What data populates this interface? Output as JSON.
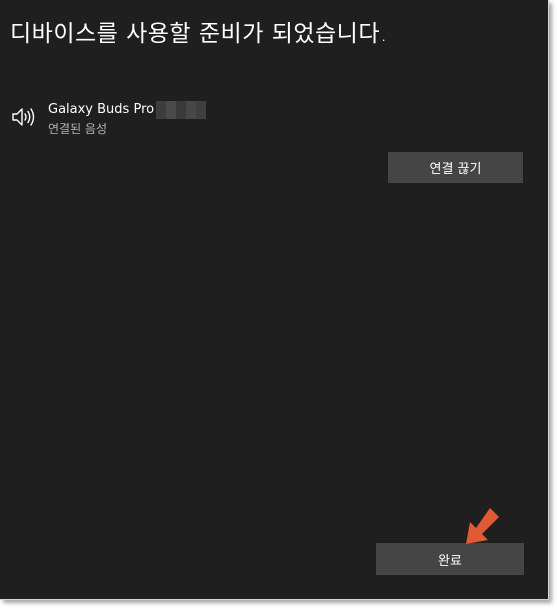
{
  "dialog": {
    "title": "디바이스를 사용할 준비가 되었습니다."
  },
  "device": {
    "icon": "speaker-icon",
    "name": "Galaxy Buds Pro",
    "status": "연결된 음성"
  },
  "buttons": {
    "disconnect_label": "연결 끊기",
    "done_label": "완료"
  },
  "annotation": {
    "icon": "arrow-icon",
    "color": "#e05a36"
  },
  "colors": {
    "background": "#1f1f1f",
    "button": "#454545",
    "text": "#ffffff",
    "secondary_text": "#b3b3b3"
  }
}
